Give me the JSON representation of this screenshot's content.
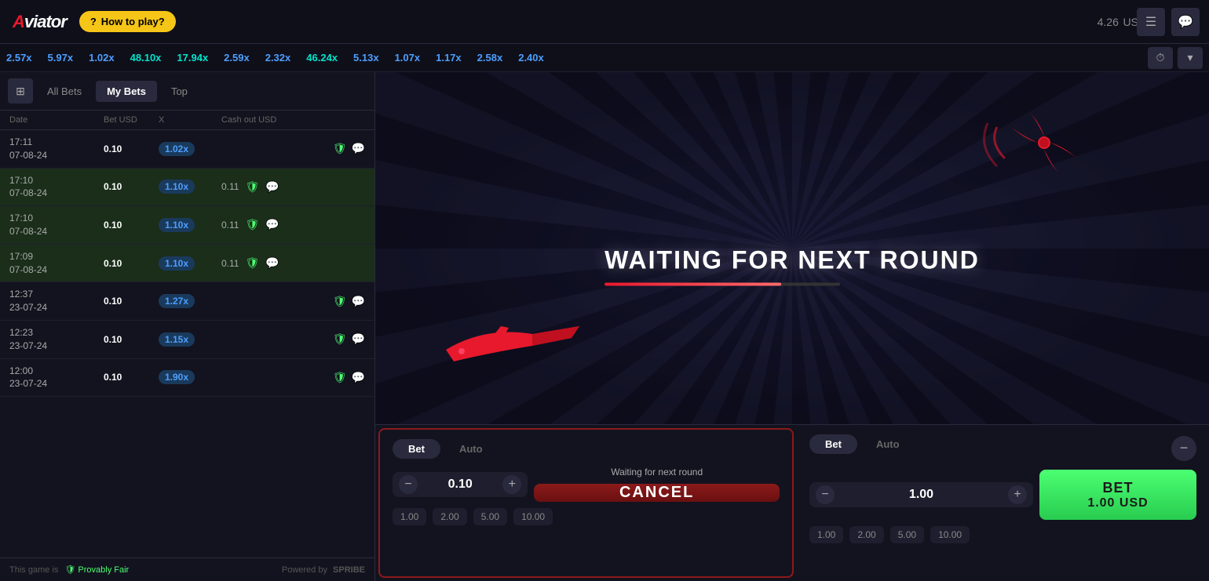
{
  "app": {
    "logo": "Aviator",
    "how_to_play": "How to play?",
    "balance": "4.26",
    "currency": "USD"
  },
  "multiplier_bar": {
    "values": [
      {
        "val": "2.57x",
        "color": "blue"
      },
      {
        "val": "5.97x",
        "color": "blue"
      },
      {
        "val": "1.02x",
        "color": "blue"
      },
      {
        "val": "48.10x",
        "color": "teal"
      },
      {
        "val": "17.94x",
        "color": "teal"
      },
      {
        "val": "2.59x",
        "color": "blue"
      },
      {
        "val": "2.32x",
        "color": "blue"
      },
      {
        "val": "46.24x",
        "color": "teal"
      },
      {
        "val": "5.13x",
        "color": "blue"
      },
      {
        "val": "1.07x",
        "color": "blue"
      },
      {
        "val": "1.17x",
        "color": "blue"
      },
      {
        "val": "2.58x",
        "color": "blue"
      },
      {
        "val": "2.40x",
        "color": "blue"
      }
    ]
  },
  "tabs": {
    "all_bets": "All Bets",
    "my_bets": "My Bets",
    "top": "Top"
  },
  "table": {
    "headers": [
      "Date",
      "Bet USD",
      "X",
      "Cash out USD"
    ],
    "rows": [
      {
        "time": "17:11",
        "date": "07-08-24",
        "bet": "0.10",
        "mult": "1.02x",
        "cashout": "",
        "green": false
      },
      {
        "time": "17:10",
        "date": "07-08-24",
        "bet": "0.10",
        "mult": "1.10x",
        "cashout": "0.11",
        "green": true
      },
      {
        "time": "17:10",
        "date": "07-08-24",
        "bet": "0.10",
        "mult": "1.10x",
        "cashout": "0.11",
        "green": true
      },
      {
        "time": "17:09",
        "date": "07-08-24",
        "bet": "0.10",
        "mult": "1.10x",
        "cashout": "0.11",
        "green": true
      },
      {
        "time": "12:37",
        "date": "23-07-24",
        "bet": "0.10",
        "mult": "1.27x",
        "cashout": "",
        "green": false
      },
      {
        "time": "12:23",
        "date": "23-07-24",
        "bet": "0.10",
        "mult": "1.15x",
        "cashout": "",
        "green": false
      },
      {
        "time": "12:00",
        "date": "23-07-24",
        "bet": "0.10",
        "mult": "1.90x",
        "cashout": "",
        "green": false
      }
    ]
  },
  "footer": {
    "text": "This game is",
    "provably_fair": "Provably Fair",
    "powered_by": "Powered by",
    "spribe": "SPRIBE"
  },
  "game": {
    "waiting_text": "WAITING FOR NEXT ROUND",
    "progress": 75
  },
  "panel1": {
    "bet_tab": "Bet",
    "auto_tab": "Auto",
    "amount": "0.10",
    "waiting_label": "Waiting for next round",
    "cancel_label": "CANCEL",
    "quick_amounts": [
      "1.00",
      "2.00",
      "5.00",
      "10.00"
    ]
  },
  "panel2": {
    "bet_tab": "Bet",
    "auto_tab": "Auto",
    "amount": "1.00",
    "bet_label": "BET",
    "bet_amount": "1.00 USD",
    "quick_amounts": [
      "1.00",
      "2.00",
      "5.00",
      "10.00"
    ]
  }
}
